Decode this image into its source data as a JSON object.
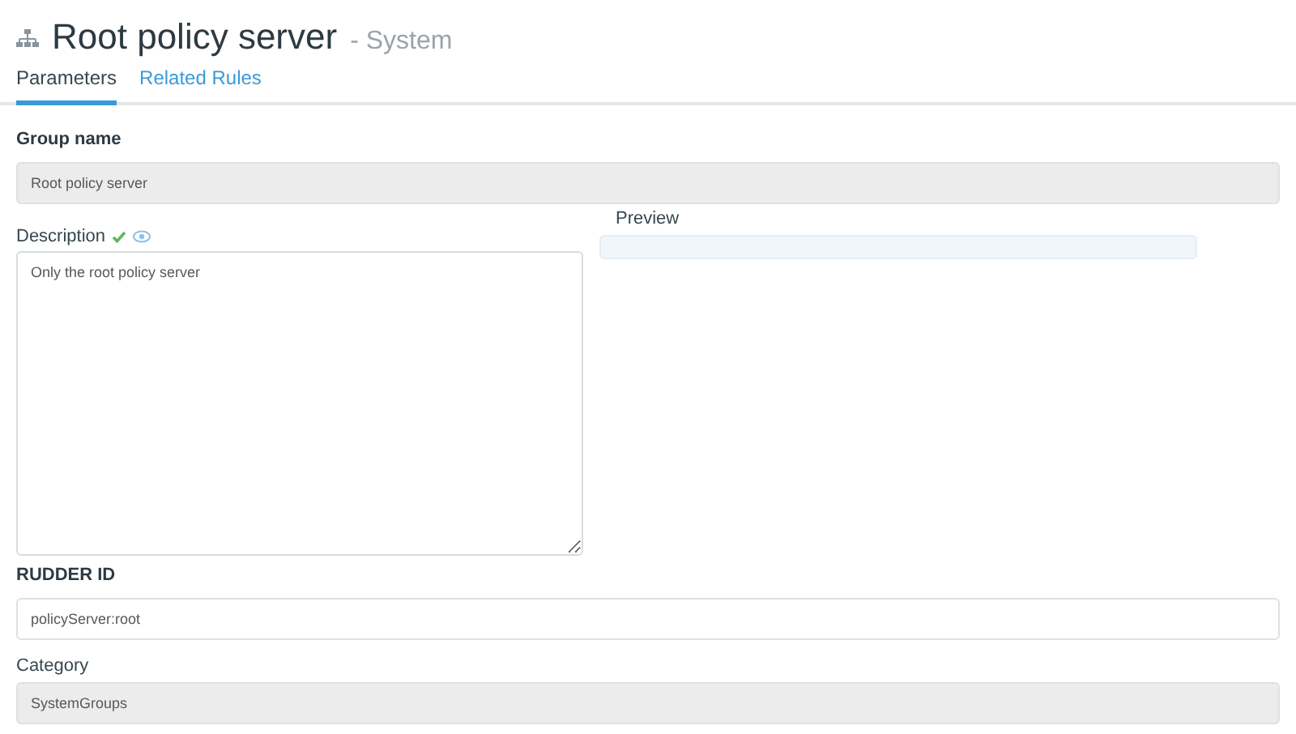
{
  "header": {
    "title": "Root policy server",
    "subtitle": "- System"
  },
  "tabs": [
    {
      "label": "Parameters",
      "selected": true
    },
    {
      "label": "Related Rules",
      "selected": false
    }
  ],
  "group_name": {
    "label": "Group name",
    "value": "Root policy server",
    "disabled": true
  },
  "description": {
    "label": "Description",
    "value": "Only the root policy server",
    "valid": true
  },
  "preview": {
    "label": "Preview"
  },
  "rudder_id": {
    "label": "RUDDER ID",
    "value": "policyServer:root",
    "disabled": false
  },
  "category": {
    "label": "Category",
    "value": "SystemGroups",
    "disabled": true
  }
}
